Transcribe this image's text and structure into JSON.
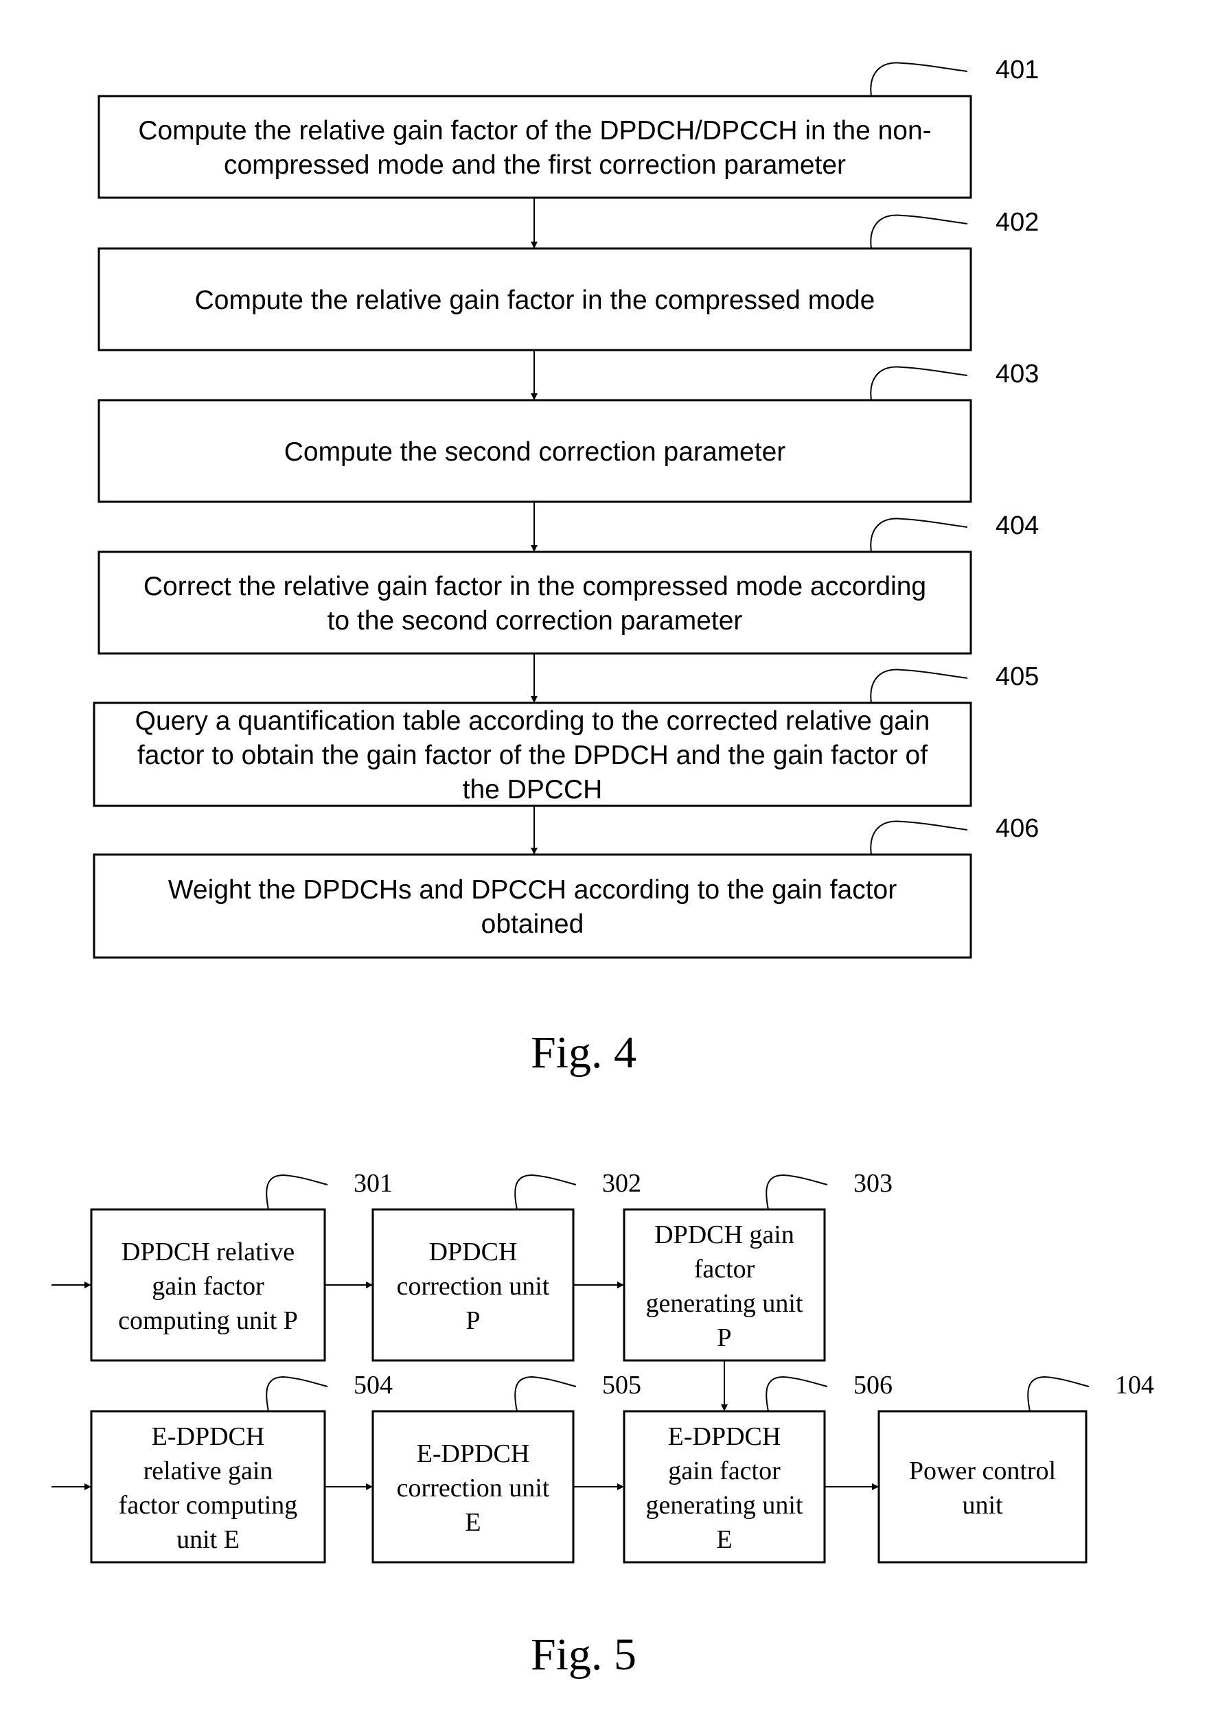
{
  "fig4": {
    "caption": "Fig. 4",
    "steps": [
      {
        "ref": "401",
        "lines": [
          "Compute the relative gain factor of the DPDCH/DPCCH in the non-",
          "compressed mode and the first correction parameter"
        ]
      },
      {
        "ref": "402",
        "lines": [
          "Compute the relative gain factor in the compressed mode"
        ]
      },
      {
        "ref": "403",
        "lines": [
          "Compute the second correction parameter"
        ]
      },
      {
        "ref": "404",
        "lines": [
          "Correct the relative gain factor in the compressed mode according",
          "to the second correction parameter"
        ]
      },
      {
        "ref": "405",
        "lines": [
          "Query a quantification table according to the corrected relative gain",
          "factor to obtain the gain factor of the DPDCH and the gain factor of",
          "the DPCCH"
        ]
      },
      {
        "ref": "406",
        "lines": [
          "Weight the DPDCHs and DPCCH according to the gain factor",
          "obtained"
        ]
      }
    ]
  },
  "fig5": {
    "caption": "Fig. 5",
    "units": [
      {
        "id": "u301",
        "ref": "301",
        "lines": [
          "DPDCH relative",
          "gain factor",
          "computing unit P"
        ]
      },
      {
        "id": "u302",
        "ref": "302",
        "lines": [
          "DPDCH",
          "correction unit",
          "P"
        ]
      },
      {
        "id": "u303",
        "ref": "303",
        "lines": [
          "DPDCH gain",
          "factor",
          "generating unit",
          "P"
        ]
      },
      {
        "id": "u504",
        "ref": "504",
        "lines": [
          "E-DPDCH",
          "relative gain",
          "factor computing",
          "unit E"
        ]
      },
      {
        "id": "u505",
        "ref": "505",
        "lines": [
          "E-DPDCH",
          "correction unit",
          "E"
        ]
      },
      {
        "id": "u506",
        "ref": "506",
        "lines": [
          "E-DPDCH",
          "gain factor",
          "generating unit",
          "E"
        ]
      },
      {
        "id": "u104",
        "ref": "104",
        "lines": [
          "Power control",
          "unit"
        ]
      }
    ]
  }
}
